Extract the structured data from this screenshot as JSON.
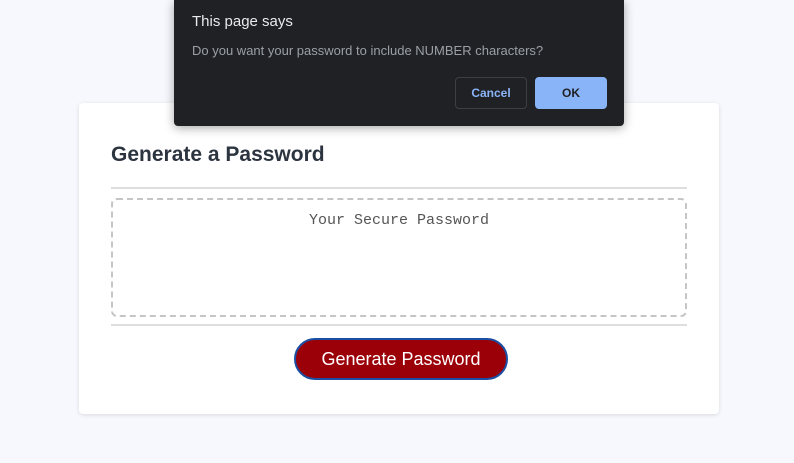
{
  "dialog": {
    "title": "This page says",
    "message": "Do you want your password to include NUMBER characters?",
    "cancel_label": "Cancel",
    "ok_label": "OK"
  },
  "card": {
    "title": "Generate a Password",
    "password_placeholder": "Your Secure Password",
    "password_value": "",
    "generate_label": "Generate Password"
  },
  "colors": {
    "page_background": "#f6f8fd",
    "card_background": "#ffffff",
    "generate_button": "#9b0008",
    "dialog_background": "#202124",
    "dialog_accent": "#8ab4f8"
  }
}
